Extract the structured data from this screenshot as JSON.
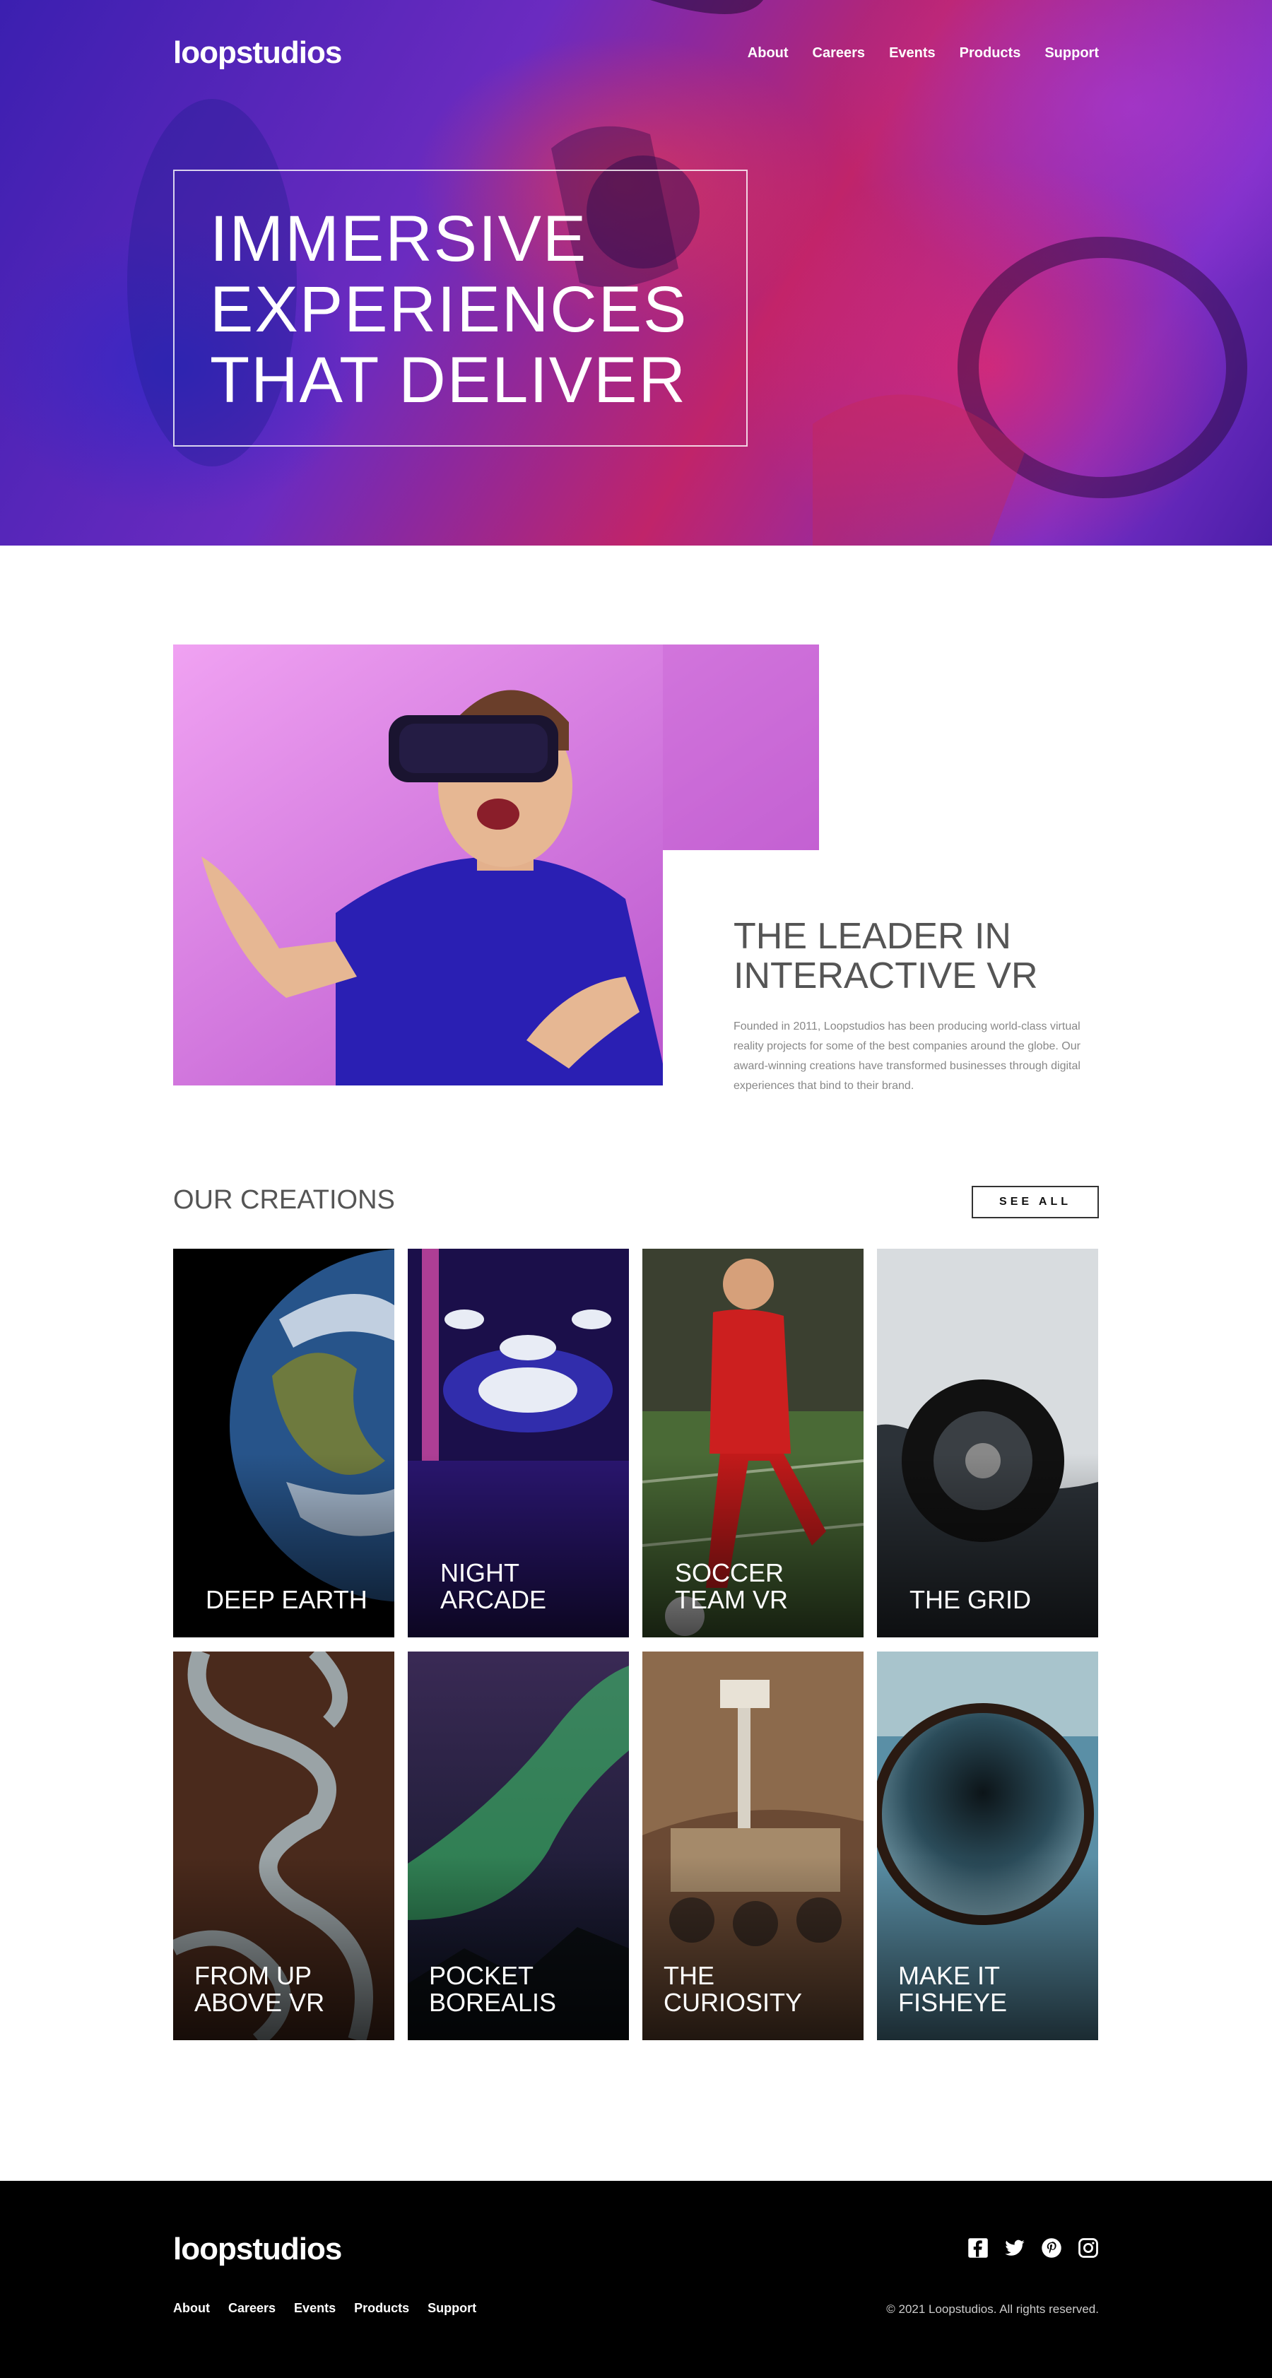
{
  "brand": {
    "logo": "loopstudios"
  },
  "nav": {
    "items": [
      "About",
      "Careers",
      "Events",
      "Products",
      "Support"
    ]
  },
  "hero": {
    "headline": "IMMERSIVE EXPERIENCES THAT DELIVER"
  },
  "about": {
    "heading": "THE LEADER IN INTERACTIVE VR",
    "body": "Founded in 2011, Loopstudios has been producing world-class virtual reality projects for some of the best companies around the globe. Our award-winning creations have transformed businesses through digital experiences that bind to their brand."
  },
  "creations": {
    "heading": "OUR CREATIONS",
    "see_all_label": "SEE ALL",
    "cards": [
      {
        "title": "DEEP EARTH"
      },
      {
        "title": "NIGHT ARCADE"
      },
      {
        "title": "SOCCER TEAM VR"
      },
      {
        "title": "THE GRID"
      },
      {
        "title": "FROM UP ABOVE VR"
      },
      {
        "title": "POCKET BOREALIS"
      },
      {
        "title": "THE CURIOSITY"
      },
      {
        "title": "MAKE IT FISHEYE"
      }
    ]
  },
  "footer": {
    "logo": "loopstudios",
    "nav": [
      "About",
      "Careers",
      "Events",
      "Products",
      "Support"
    ],
    "social_icons": [
      "facebook-icon",
      "twitter-icon",
      "pinterest-icon",
      "instagram-icon"
    ],
    "copyright": "© 2021 Loopstudios. All rights reserved."
  }
}
